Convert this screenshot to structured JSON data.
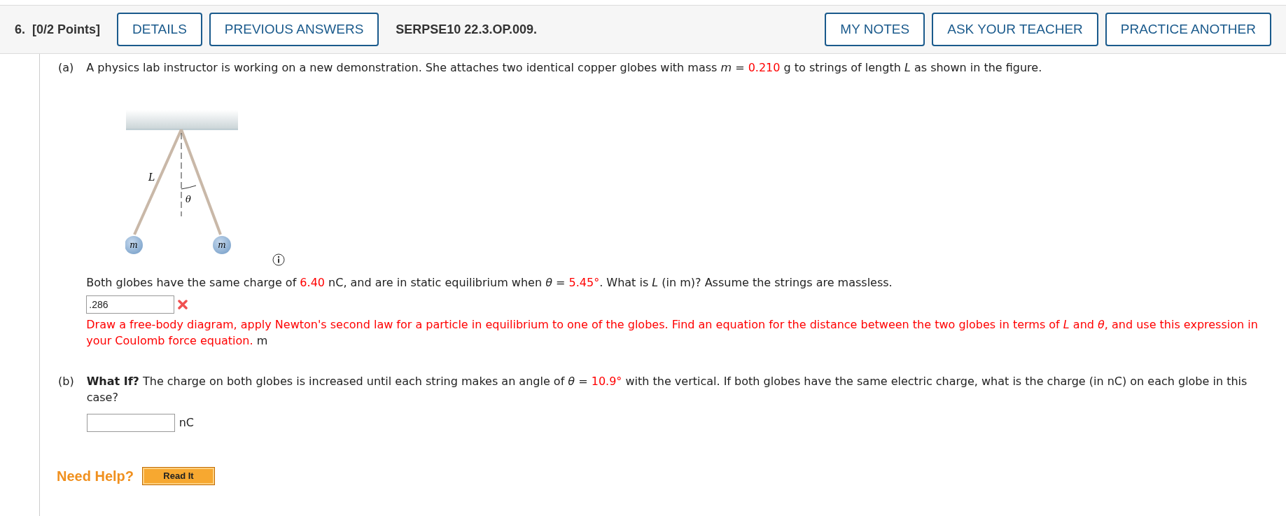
{
  "header": {
    "number": "6.",
    "points": "[0/2 Points]",
    "buttons_left": [
      "DETAILS",
      "PREVIOUS ANSWERS"
    ],
    "code": "SERPSE10 22.3.OP.009.",
    "buttons_right": [
      "MY NOTES",
      "ASK YOUR TEACHER",
      "PRACTICE ANOTHER"
    ]
  },
  "part_a": {
    "label": "(a)",
    "intro": [
      {
        "text": "A physics lab instructor is working on a new demonstration. She attaches two identical copper globes with mass *m* = ",
        "red": false
      },
      {
        "text": "0.210",
        "red": true
      },
      {
        "text": " g to strings of length *L* as shown in the figure.",
        "red": false
      }
    ],
    "figure": {
      "length_label": "L",
      "angle_label": "θ",
      "mass_labels": [
        "m",
        "m"
      ]
    },
    "question": [
      {
        "text": "Both globes have the same charge of ",
        "red": false
      },
      {
        "text": "6.40",
        "red": true
      },
      {
        "text": " nC, and are in static equilibrium when *θ* = ",
        "red": false
      },
      {
        "text": "5.45°",
        "red": true
      },
      {
        "text": ". What is *L* (in m)? Assume the strings are massless.",
        "red": false
      }
    ],
    "answer": {
      "value": ".286",
      "correct": false
    },
    "hint": "Draw a free-body diagram, apply Newton's second law for a particle in equilibrium to one of the globes. Find an equation for the distance between the two globes in terms of *L* and *θ*, and use this expression in your Coulomb force equation.",
    "unit": "m"
  },
  "part_b": {
    "label": "(b)",
    "question": [
      {
        "text": "**What If?** The charge on both globes is increased until each string makes an angle of *θ* = ",
        "red": false
      },
      {
        "text": "10.9°",
        "red": true
      },
      {
        "text": " with the vertical. If both globes have the same electric charge, what is the charge (in nC) on each globe in this case?",
        "red": false
      }
    ],
    "unit": "nC"
  },
  "help": {
    "label": "Need Help?",
    "button": "Read It"
  }
}
